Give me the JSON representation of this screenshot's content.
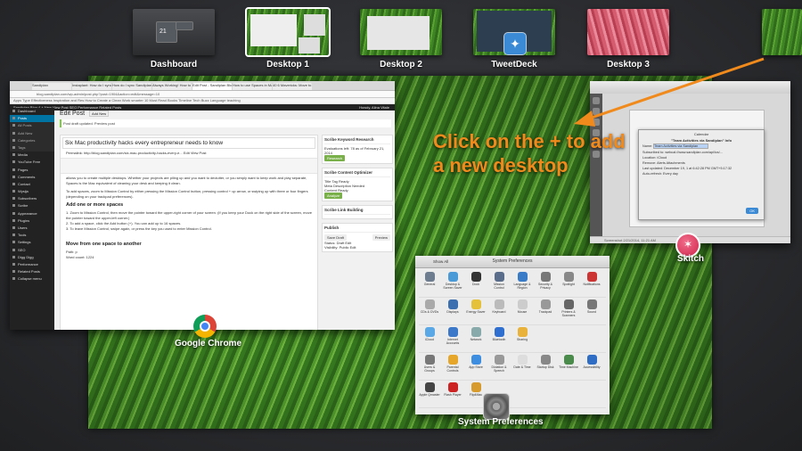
{
  "spaces": [
    {
      "label": "Dashboard",
      "style": "dash",
      "active": false
    },
    {
      "label": "Desktop 1",
      "style": "grass",
      "active": true
    },
    {
      "label": "Desktop 2",
      "style": "grass",
      "active": false
    },
    {
      "label": "TweetDeck",
      "style": "grass",
      "active": false
    },
    {
      "label": "Desktop 3",
      "style": "pink",
      "active": false
    }
  ],
  "dashboard_clock": "21",
  "callout": {
    "line1": "Click on the + to add",
    "line2": "a new desktop"
  },
  "apps": {
    "chrome": "Google Chrome",
    "skitch": "Skitch",
    "sysprefs": "System Preferences"
  },
  "chrome_window": {
    "tabs": [
      "Sandiplan",
      "Instaplant: How do I sync",
      "How do I sync Sandiplan",
      "Always Working! How to",
      "Edit Post - Sandiplan Blog",
      "How to use Spaces in Mac",
      "40 6 Mavericks: Move to"
    ],
    "address": "blog.sandiplan.com/wp-admin/post.php?post=1904&action=edit&message=10",
    "bookmarks": "Apps  Type Effectiveness  Inspiration and Res  How to Create a Clean  Work smarter  10 Must Read Books  Timeline Tech Buzz  Language teaching",
    "wpbar": "Sandiplan Blog   4   +   New   View Post   SEO   Performance   Related Posts",
    "howdy": "Howdy, Alina Vitale",
    "sidebar": [
      "Dashboard",
      "Posts",
      "All Posts",
      "Add New",
      "Categories",
      "Tags",
      "Media",
      "YouTube Free",
      "Pages",
      "Comments",
      "Contact",
      "Wysija",
      "Subscribers",
      "Scribe",
      "Appearance",
      "Plugins",
      "Users",
      "Tools",
      "Settings",
      "SEO",
      "Digg Digg",
      "Performance",
      "Related Posts",
      "Collapse menu"
    ],
    "page_title": "Edit Post",
    "add_new": "Add New",
    "notice": "Post draft updated. Preview post",
    "post_title": "Six Mac productivity hacks every entrepreneur needs to know",
    "permalink": "Permalink: http://blog.sandiplan.com/six-mac-productivity-hacks-every-e...  Edit  View Post",
    "p1": "allows you to create multiple desktops. Whether your projects are piling up and you want to declutter, or you simply want to keep work and play separate, Spaces is the Mac equivalent of cleaning your desk and keeping it clean.",
    "p2": "To add spaces, zoom to Mission Control by either pressing the Mission Control button, pressing control + up arrow, or swiping up with three or four fingers (depending on your trackpad preferences).",
    "h1": "Add one or more spaces",
    "list": [
      "1. Zoom to Mission Control, then move the pointer toward the upper-right corner of your screen. (If you keep your Dock on the right side of the screen, move the pointer toward the upper-left corner.)",
      "2. To add a space, click the Add button (+). You can add up to 16 spaces.",
      "3. To leave Mission Control, swipe again, or press the key you used to enter Mission Control."
    ],
    "h2": "Move from one space to another",
    "path": "Path: p",
    "wordcount": "Word count: 1224",
    "lastedit": "Draft saved at 11:19:11 am. Last edited by Alina Vitale on February 21, 2014 at 11:16 am",
    "boxes": {
      "keyword_title": "Scribe Keyword Research",
      "keyword_text": "Evaluations left: 78 as of February 21, 2014",
      "keyword_btn": "Research",
      "optimizer_title": "Scribe Content Optimizer",
      "optimizer_items": [
        "Title Tag Ready",
        "Meta Description Needed",
        "Content Ready"
      ],
      "optimizer_btn": "Analyze",
      "link_title": "Scribe Link Building",
      "publish_title": "Publish",
      "save_draft": "Save Draft",
      "preview": "Preview",
      "status": "Status: Draft Edit",
      "visibility": "Visibility: Public Edit"
    }
  },
  "skitch_window": {
    "dialog_title": "Calendar",
    "dialog_heading": "\"Team Activities via Sandiplan\" Info",
    "rows": [
      {
        "k": "Name:",
        "v": "Team Activities via Sandiplan"
      },
      {
        "k": "Subscribed to:",
        "v": "webcal://www.sandiplan.com/api/ics/..."
      },
      {
        "k": "Location:",
        "v": "iCloud"
      },
      {
        "k": "Remove:",
        "v": "Alerts  Attachments"
      },
      {
        "k": "Last updated:",
        "v": "December 19, 1 at 6:42:28 PM GMT+5:17:32"
      },
      {
        "k": "Auto-refresh:",
        "v": "Every day"
      }
    ],
    "ok": "OK",
    "status": "Screenshot 2/21/2014, 11:21 AM"
  },
  "syspref_window": {
    "title": "System Preferences",
    "show_all": "Show All",
    "rows": [
      [
        {
          "n": "General",
          "c": "#6d7d8f"
        },
        {
          "n": "Desktop & Screen Saver",
          "c": "#4a9ad8"
        },
        {
          "n": "Dock",
          "c": "#333"
        },
        {
          "n": "Mission Control",
          "c": "#5a6d8a"
        },
        {
          "n": "Language & Region",
          "c": "#3a7bc8"
        },
        {
          "n": "Security & Privacy",
          "c": "#777"
        },
        {
          "n": "Spotlight",
          "c": "#888"
        },
        {
          "n": "Notifications",
          "c": "#c33"
        }
      ],
      [
        {
          "n": "CDs & DVDs",
          "c": "#aaa"
        },
        {
          "n": "Displays",
          "c": "#3b6fb0"
        },
        {
          "n": "Energy Saver",
          "c": "#e5c13a"
        },
        {
          "n": "Keyboard",
          "c": "#bbb"
        },
        {
          "n": "Mouse",
          "c": "#ccc"
        },
        {
          "n": "Trackpad",
          "c": "#999"
        },
        {
          "n": "Printers & Scanners",
          "c": "#666"
        },
        {
          "n": "Sound",
          "c": "#777"
        }
      ],
      [
        {
          "n": "iCloud",
          "c": "#5aa9e6"
        },
        {
          "n": "Internet Accounts",
          "c": "#3c78c9"
        },
        {
          "n": "Network",
          "c": "#8aa"
        },
        {
          "n": "Bluetooth",
          "c": "#2e6fd0"
        },
        {
          "n": "Sharing",
          "c": "#e9b23a"
        }
      ],
      [
        {
          "n": "Users & Groups",
          "c": "#777"
        },
        {
          "n": "Parental Controls",
          "c": "#e5a62a"
        },
        {
          "n": "App Store",
          "c": "#3d8de0"
        },
        {
          "n": "Dictation & Speech",
          "c": "#999"
        },
        {
          "n": "Date & Time",
          "c": "#ddd"
        },
        {
          "n": "Startup Disk",
          "c": "#888"
        },
        {
          "n": "Time Machine",
          "c": "#4a8a4a"
        },
        {
          "n": "Accessibility",
          "c": "#2f6cc3"
        }
      ],
      [
        {
          "n": "Apple Qmaster",
          "c": "#444"
        },
        {
          "n": "Flash Player",
          "c": "#c22"
        },
        {
          "n": "Flip4Mac",
          "c": "#d69b2c"
        }
      ]
    ]
  }
}
